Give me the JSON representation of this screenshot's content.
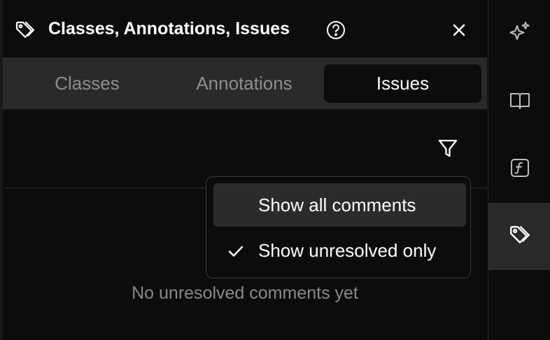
{
  "header": {
    "title": "Classes, Annotations, Issues",
    "left_icon": "tag-icon",
    "help_icon": "help-circle-icon",
    "close_icon": "close-icon"
  },
  "tabs": [
    {
      "label": "Classes",
      "active": false
    },
    {
      "label": "Annotations",
      "active": false
    },
    {
      "label": "Issues",
      "active": true
    }
  ],
  "toolbar": {
    "filter_icon": "filter-icon"
  },
  "filter_menu": {
    "items": [
      {
        "label": "Show all comments",
        "checked": false,
        "highlighted": true
      },
      {
        "label": "Show unresolved only",
        "checked": true,
        "highlighted": false
      }
    ]
  },
  "empty_state": {
    "message": "No unresolved comments yet"
  },
  "rail": {
    "items": [
      {
        "icon": "sparkles-icon",
        "active": false
      },
      {
        "icon": "book-icon",
        "active": false
      },
      {
        "icon": "function-icon",
        "active": false
      },
      {
        "icon": "tag-icon",
        "active": true
      }
    ]
  },
  "colors": {
    "background": "#0d0c0c",
    "tab_bar": "#2b2a2a",
    "muted_text": "#8a8989",
    "text": "#ffffff"
  }
}
